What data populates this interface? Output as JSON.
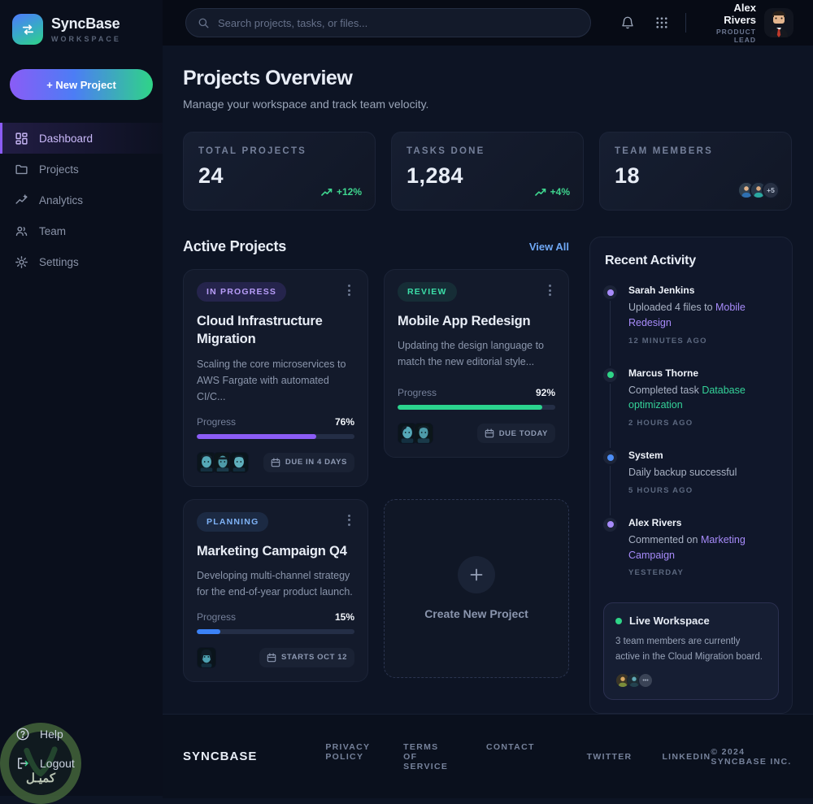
{
  "brand": {
    "name": "SyncBase",
    "tagline": "WORKSPACE"
  },
  "sidebar": {
    "new_project_label": "+  New Project",
    "items": [
      {
        "label": "Dashboard",
        "active": true
      },
      {
        "label": "Projects",
        "active": false
      },
      {
        "label": "Analytics",
        "active": false
      },
      {
        "label": "Team",
        "active": false
      },
      {
        "label": "Settings",
        "active": false
      }
    ],
    "help_label": "Help",
    "logout_label": "Logout"
  },
  "topbar": {
    "search_placeholder": "Search projects, tasks, or files...",
    "user": {
      "name": "Alex Rivers",
      "role": "PRODUCT LEAD"
    }
  },
  "overview": {
    "title": "Projects Overview",
    "subtitle": "Manage your workspace and track team velocity.",
    "stats": [
      {
        "label": "TOTAL PROJECTS",
        "value": "24",
        "trend": "+12%"
      },
      {
        "label": "TASKS DONE",
        "value": "1,284",
        "trend": "+4%"
      },
      {
        "label": "TEAM MEMBERS",
        "value": "18",
        "more": "+5"
      }
    ]
  },
  "active_projects": {
    "title": "Active Projects",
    "view_all_label": "View All",
    "cards": [
      {
        "badge": "IN PROGRESS",
        "title": "Cloud Infrastructure Migration",
        "description": "Scaling the core microservices to AWS Fargate with automated CI/C...",
        "progress_label": "Progress",
        "progress": "76%",
        "due": "DUE IN 4 DAYS"
      },
      {
        "badge": "REVIEW",
        "title": "Mobile App Redesign",
        "description": "Updating the design language to match the new editorial style...",
        "progress_label": "Progress",
        "progress": "92%",
        "due": "DUE TODAY"
      },
      {
        "badge": "PLANNING",
        "title": "Marketing Campaign Q4",
        "description": "Developing multi-channel strategy for the end-of-year product launch.",
        "progress_label": "Progress",
        "progress": "15%",
        "due": "STARTS OCT 12"
      }
    ],
    "create_label": "Create New Project"
  },
  "recent_activity": {
    "title": "Recent Activity",
    "items": [
      {
        "actor": "Sarah Jenkins",
        "text": "Uploaded 4 files to ",
        "link": "Mobile Redesign",
        "time": "12 MINUTES AGO"
      },
      {
        "actor": "Marcus Thorne",
        "text": "Completed task ",
        "link": "Database optimization",
        "time": "2 HOURS AGO"
      },
      {
        "actor": "System",
        "text": "Daily backup successful",
        "link": "",
        "time": "5 HOURS AGO"
      },
      {
        "actor": "Alex Rivers",
        "text": "Commented on ",
        "link": "Marketing Campaign",
        "time": "YESTERDAY"
      }
    ],
    "live": {
      "title": "Live Workspace",
      "text": "3 team members are currently active in the Cloud Migration board."
    }
  },
  "footer": {
    "brand": "SYNCBASE",
    "links": [
      "PRIVACY POLICY",
      "TERMS OF SERVICE",
      "CONTACT"
    ],
    "social": [
      "TWITTER",
      "LINKEDIN"
    ],
    "copyright": "© 2024 SYNCBASE INC."
  },
  "watermark": {
    "text": "كميـل"
  },
  "colors": {
    "accent_purple": "#8B5CF6",
    "accent_green": "#2FD487",
    "accent_blue": "#3B82F6",
    "link_blue": "#6FA8F5",
    "background": "#0D1424",
    "card": "#131A2B"
  }
}
